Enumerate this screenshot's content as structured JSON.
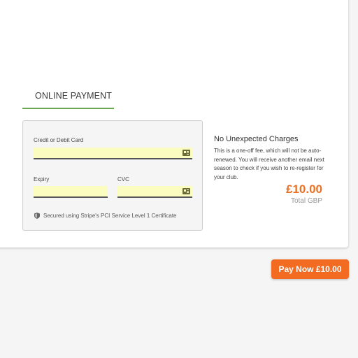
{
  "tab": {
    "title": "ONLINE PAYMENT"
  },
  "form": {
    "card_label": "Credit or Debit Card",
    "expiry_label": "Expiry",
    "cvc_label": "CVC",
    "secure_text": "Secured using Stripe's PCI Service Level 1 Certificate",
    "field_color": "#fbfcc0"
  },
  "info": {
    "title": "No Unexpected Charges",
    "text": "This is a one-off fee, which will not be auto-renewed. You will receive another email next season to check if you wish to re-register for your club.",
    "price": "£10.00",
    "price_sub": "Total GBP",
    "accent_color": "#e8712a"
  },
  "pay_button": {
    "label": "Pay Now £10.00",
    "color": "#f26b21"
  },
  "icons": [
    "card-icon",
    "shield-icon"
  ]
}
